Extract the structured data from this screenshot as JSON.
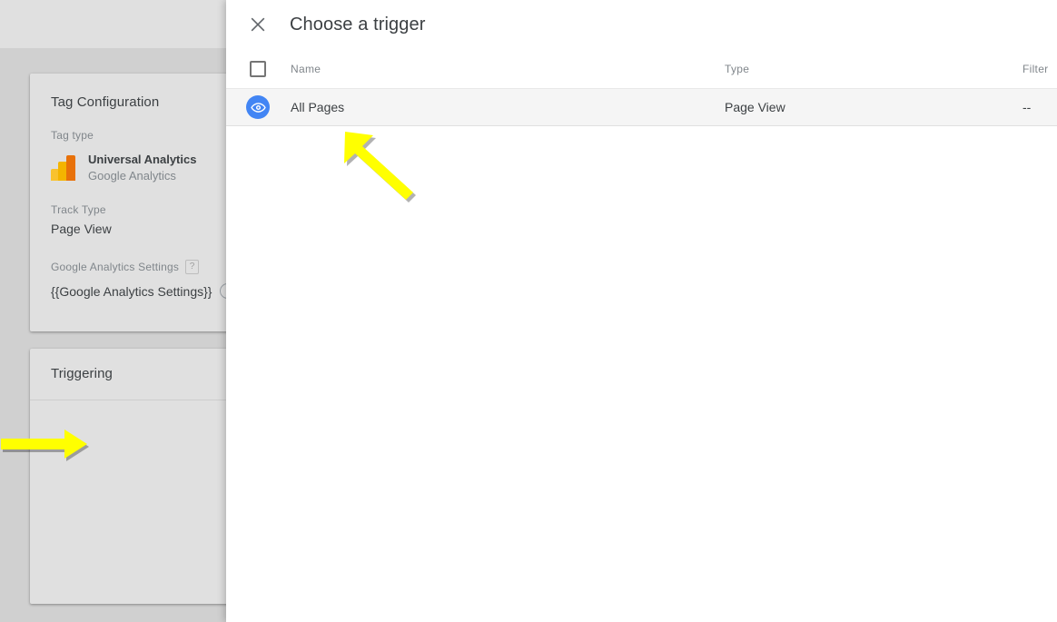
{
  "workspace": {
    "tag_configuration_card": {
      "title": "Tag Configuration",
      "tag_type_label": "Tag type",
      "tag_type_name": "Universal Analytics",
      "tag_type_vendor": "Google Analytics",
      "tag_type_icon": "google-analytics-logo",
      "track_type_label": "Track Type",
      "track_type_value": "Page View",
      "ga_settings_label": "Google Analytics Settings",
      "ga_settings_help": "?",
      "ga_settings_value": "{{Google Analytics Settings}}",
      "ga_settings_info_icon": "info-icon"
    },
    "triggering_card": {
      "title": "Triggering"
    },
    "annotation_arrow_left": {
      "icon": "arrow-right-annotation",
      "color": "#ffff00"
    }
  },
  "dialog": {
    "title": "Choose a trigger",
    "close_icon": "close-icon",
    "table": {
      "columns": [
        "Name",
        "Type",
        "Filter"
      ],
      "select_all_checkbox": "select-all-checkbox",
      "rows": [
        {
          "status_icon": "eye-icon",
          "name": "All Pages",
          "type": "Page View",
          "filter": "--"
        }
      ]
    },
    "annotation_arrow": {
      "icon": "arrow-up-left-annotation",
      "color": "#ffff00"
    }
  },
  "colors": {
    "accent_blue": "#4285f4",
    "annotation_yellow": "#ffff00",
    "card_background": "#e0e0e0",
    "workspace_background": "#d0d0d0",
    "dialog_background": "#ffffff",
    "row_highlight": "#f5f5f5"
  }
}
